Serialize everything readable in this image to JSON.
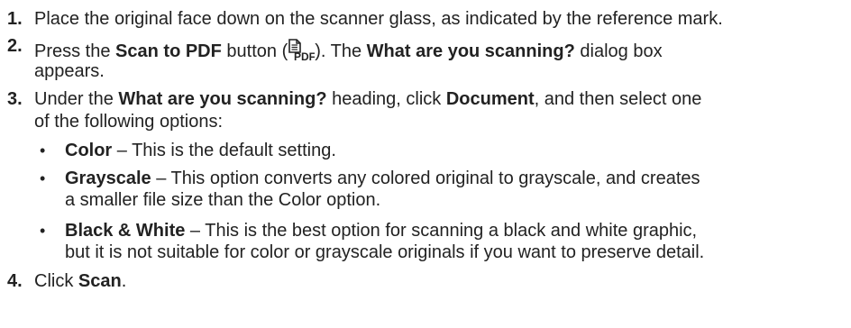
{
  "steps": [
    {
      "number": "1.",
      "text": "Place the original face down on the scanner glass, as indicated by the reference mark."
    },
    {
      "number": "2.",
      "prefix": "Press the ",
      "button_name": "Scan to PDF",
      "middle": " button (",
      "icon": "scan-to-pdf-icon",
      "icon_label": "PDF",
      "after_icon": "). The ",
      "dialog_name": "What are you scanning?",
      "suffix": " dialog box",
      "line2": "appears."
    },
    {
      "number": "3.",
      "prefix": "Under the ",
      "heading_name": "What are you scanning?",
      "middle": " heading, click ",
      "option_name": "Document",
      "suffix": ", and then select one",
      "line2": "of the following options:"
    },
    {
      "number": "4.",
      "prefix": "Click ",
      "button_name": "Scan",
      "suffix": "."
    }
  ],
  "options": [
    {
      "bullet": "•",
      "name": "Color",
      "text": " – This is the default setting."
    },
    {
      "bullet": "•",
      "name": "Grayscale",
      "text": " – This option converts any colored original to grayscale, and creates",
      "line2": "a smaller file size than the Color option."
    },
    {
      "bullet": "•",
      "name": "Black & White",
      "text": " – This is the best option for scanning a black and white graphic,",
      "line2": "but it is not suitable for color or grayscale originals if you want to preserve detail."
    }
  ]
}
